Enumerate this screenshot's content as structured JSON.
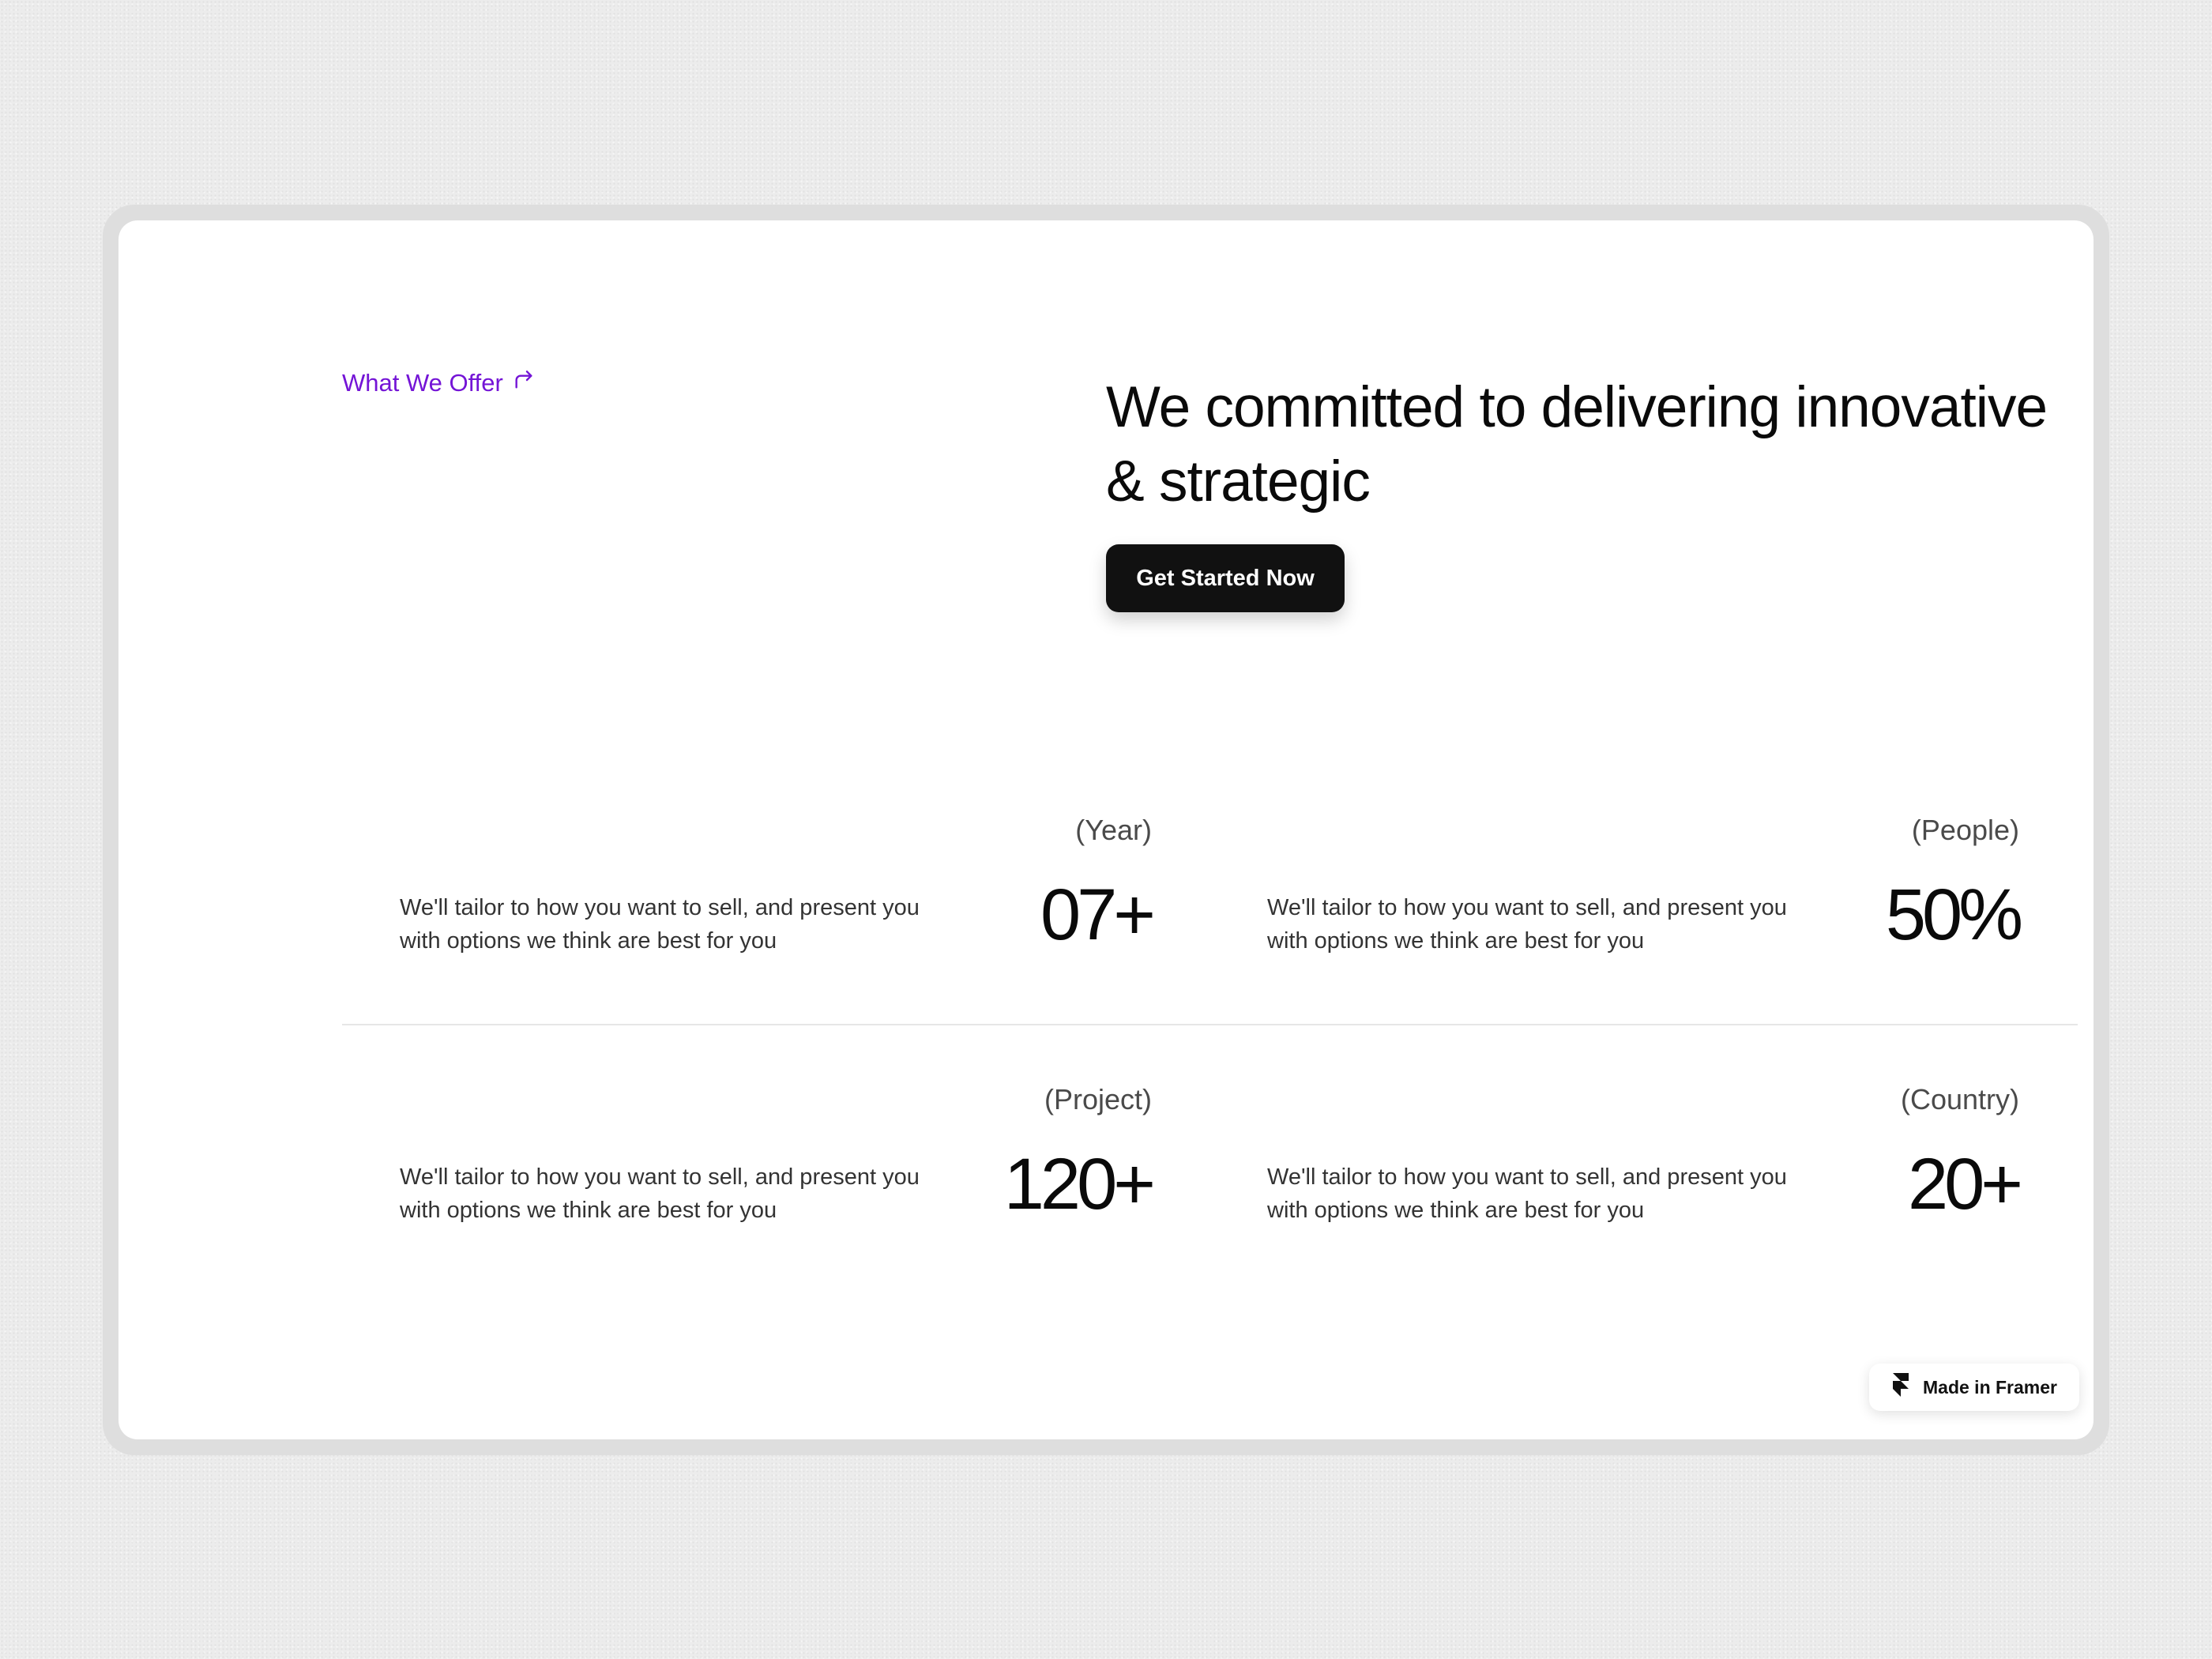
{
  "section": {
    "eyebrow_label": "What We Offer",
    "eyebrow_icon": "arrow-turn-right-icon",
    "headline": "We committed to delivering innovative & strategic",
    "cta_label": "Get Started Now"
  },
  "stats": [
    {
      "label": "(Year)",
      "value": "07+",
      "description": "We'll tailor to how you want to sell, and present you with options we think are best for you"
    },
    {
      "label": "(People)",
      "value": "50%",
      "description": "We'll tailor to how you want to sell, and present you with options we think are best for you"
    },
    {
      "label": "(Project)",
      "value": "120+",
      "description": "We'll tailor to how you want to sell, and present you with options we think are best for you"
    },
    {
      "label": "(Country)",
      "value": "20+",
      "description": "We'll tailor to how you want to sell, and present you with options we think are best for you"
    }
  ],
  "badge": {
    "label": "Made in Framer",
    "icon": "framer-logo-icon"
  },
  "colors": {
    "accent": "#7414d6",
    "button_bg": "#111111",
    "text": "#0a0a0a",
    "frame": "#dedede",
    "background": "#ececec"
  }
}
